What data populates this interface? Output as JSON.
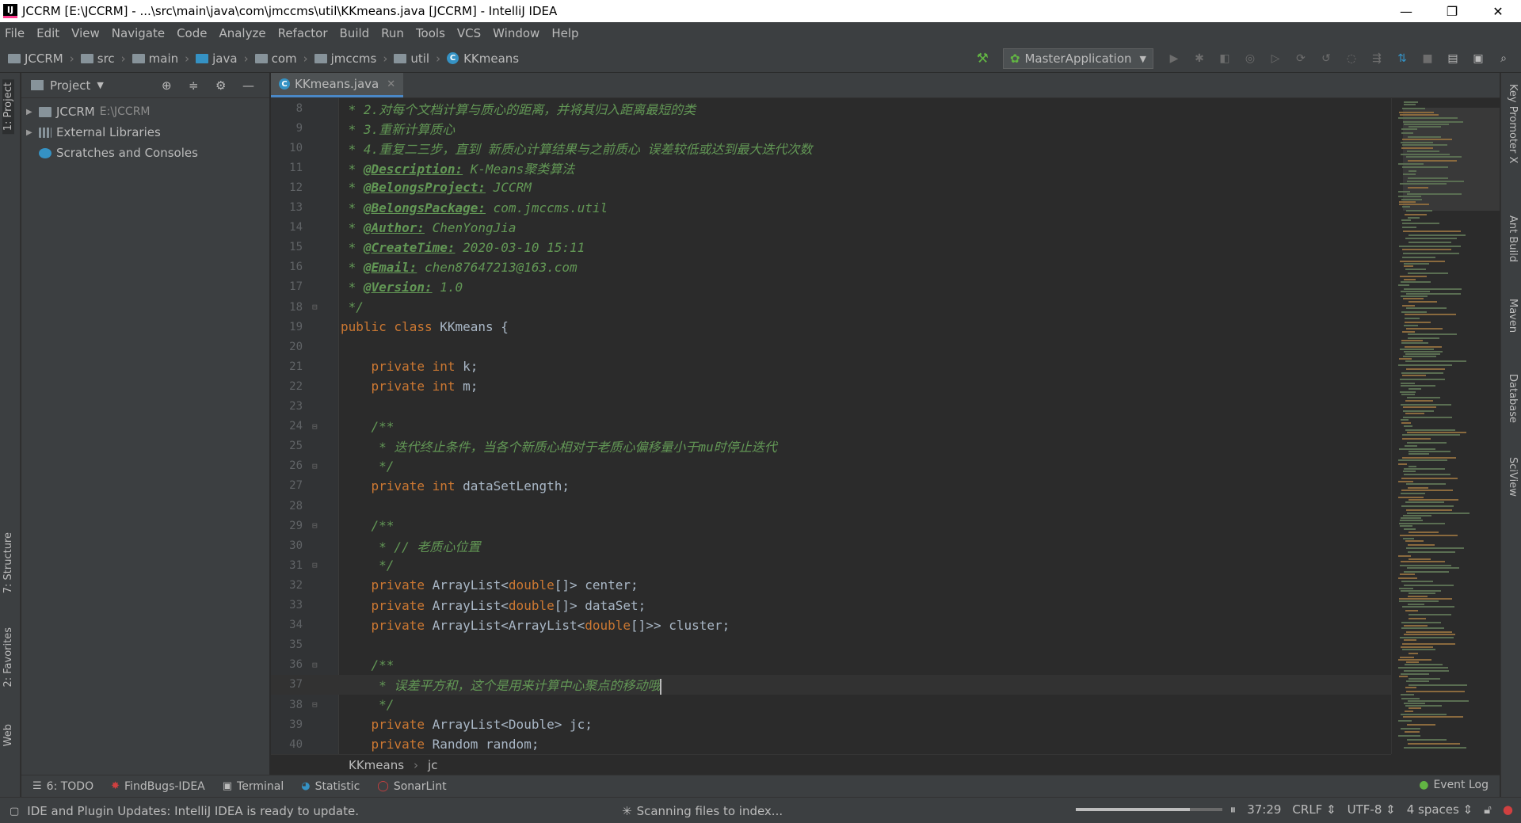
{
  "window": {
    "title": "JCCRM [E:\\JCCRM] - ...\\src\\main\\java\\com\\jmccms\\util\\KKmeans.java [JCCRM] - IntelliJ IDEA",
    "icon": "intellij-icon",
    "minimize": "—",
    "restore": "❐",
    "close": "✕"
  },
  "menu": [
    "File",
    "Edit",
    "View",
    "Navigate",
    "Code",
    "Analyze",
    "Refactor",
    "Build",
    "Run",
    "Tools",
    "VCS",
    "Window",
    "Help"
  ],
  "breadcrumbs": [
    "JCCRM",
    "src",
    "main",
    "java",
    "com",
    "jmccms",
    "util",
    "KKmeans"
  ],
  "run_config": "MasterApplication",
  "left_tabs": {
    "project": "1: Project",
    "structure": "7: Structure",
    "favorites": "2: Favorites",
    "web": "Web"
  },
  "right_tabs": {
    "key_promoter": "Key Promoter X",
    "ant": "Ant Build",
    "maven": "Maven",
    "database": "Database",
    "sciview": "SciView"
  },
  "project_panel": {
    "title": "Project",
    "items": [
      {
        "label": "JCCRM",
        "path": "E:\\JCCRM",
        "icon": "module-folder-icon"
      },
      {
        "label": "External Libraries",
        "icon": "library-icon"
      },
      {
        "label": "Scratches and Consoles",
        "icon": "scratches-icon"
      }
    ]
  },
  "editor": {
    "tab": "KKmeans.java",
    "cursor_line": 37,
    "lines": [
      {
        "n": "8",
        "t": " * 2.对每个文档计算与质心的距离，并将其归入距离最短的类"
      },
      {
        "n": "9",
        "t": " * 3.重新计算质心"
      },
      {
        "n": "10",
        "t": " * 4.重复二三步，直到 新质心计算结果与之前质心 误差较低或达到最大迭代次数"
      },
      {
        "n": "11",
        "tag": "@Description:",
        "t": " K-Means聚类算法"
      },
      {
        "n": "12",
        "tag": "@BelongsProject:",
        "t": " JCCRM"
      },
      {
        "n": "13",
        "tag": "@BelongsPackage:",
        "t": " com.jmccms.util"
      },
      {
        "n": "14",
        "tag": "@Author:",
        "t": " ChenYongJia"
      },
      {
        "n": "15",
        "tag": "@CreateTime:",
        "t": " 2020-03-10 15:11"
      },
      {
        "n": "16",
        "tag": "@Email:",
        "t": " chen87647213@163.com"
      },
      {
        "n": "17",
        "tag": "@Version:",
        "t": " 1.0"
      },
      {
        "n": "18",
        "t": " */"
      },
      {
        "n": "19",
        "kw": "public class ",
        "t": "KKmeans {"
      },
      {
        "n": "20",
        "t": ""
      },
      {
        "n": "21",
        "kw": "    private int ",
        "t": "k;"
      },
      {
        "n": "22",
        "kw": "    private int ",
        "t": "m;"
      },
      {
        "n": "23",
        "t": ""
      },
      {
        "n": "24",
        "t": "    /**"
      },
      {
        "n": "25",
        "t": "     * 迭代终止条件，当各个新质心相对于老质心偏移量小于mu时停止迭代"
      },
      {
        "n": "26",
        "t": "     */"
      },
      {
        "n": "27",
        "kw": "    private int ",
        "t": "dataSetLength;"
      },
      {
        "n": "28",
        "t": ""
      },
      {
        "n": "29",
        "t": "    /**"
      },
      {
        "n": "30",
        "t": "     * // 老质心位置"
      },
      {
        "n": "31",
        "t": "     */"
      },
      {
        "n": "32",
        "kw": "    private ",
        "t": "ArrayList<",
        "kw2": "double",
        "t2": "[]> center;"
      },
      {
        "n": "33",
        "kw": "    private ",
        "t": "ArrayList<",
        "kw2": "double",
        "t2": "[]> dataSet;"
      },
      {
        "n": "34",
        "kw": "    private ",
        "t": "ArrayList<ArrayList<",
        "kw2": "double",
        "t2": "[]>> cluster;"
      },
      {
        "n": "35",
        "t": ""
      },
      {
        "n": "36",
        "t": "    /**"
      },
      {
        "n": "37",
        "t": "     * 误差平方和，这个是用来计算中心聚点的移动哦"
      },
      {
        "n": "38",
        "t": "     */"
      },
      {
        "n": "39",
        "kw": "    private ",
        "t": "ArrayList<Double> jc;"
      },
      {
        "n": "40",
        "kw": "    private ",
        "t": "Random random;"
      }
    ],
    "crumbs": [
      "KKmeans",
      "jc"
    ]
  },
  "tool_windows": [
    "6: TODO",
    "FindBugs-IDEA",
    "Terminal",
    "Statistic",
    "SonarLint"
  ],
  "event_log": "Event Log",
  "status": {
    "message": "IDE and Plugin Updates: IntelliJ IDEA is ready to update.",
    "indexing": "Scanning files to index...",
    "progress": 0.78,
    "position": "37:29",
    "line_sep": "CRLF ⇕",
    "encoding": "UTF-8 ⇕",
    "indent": "4 spaces ⇕"
  },
  "colors": {
    "comment": "#629755",
    "keyword": "#cc7832",
    "identifier": "#a9b7c6",
    "accent": "#4a88c7"
  }
}
